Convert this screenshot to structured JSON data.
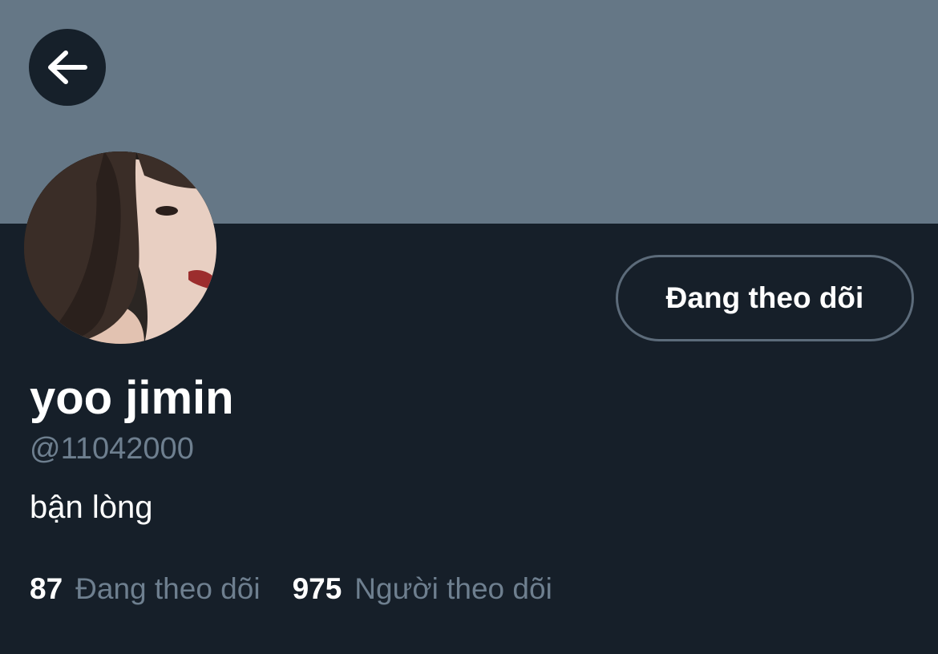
{
  "header": {
    "back_icon": "arrow-left-icon",
    "banner_color": "#657786"
  },
  "profile": {
    "display_name": "yoo jimin",
    "handle": "@11042000",
    "bio": "bận lòng",
    "follow_button_label": "Đang theo dõi"
  },
  "stats": {
    "following_count": "87",
    "following_label": "Đang theo dõi",
    "followers_count": "975",
    "followers_label": "Người theo dõi"
  },
  "colors": {
    "background": "#161f29",
    "secondary_text": "#6e7f8f",
    "primary_text": "#ffffff"
  }
}
